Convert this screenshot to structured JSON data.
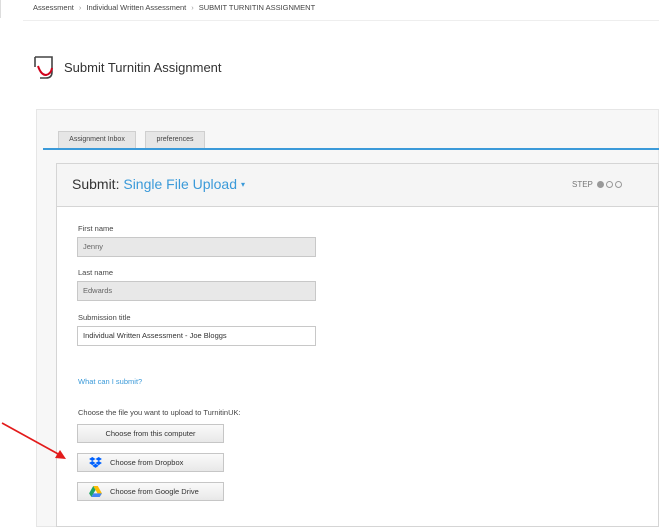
{
  "breadcrumb": {
    "item1": "Assessment",
    "item2": "Individual Written Assessment",
    "item3": "SUBMIT TURNITIN ASSIGNMENT",
    "separator": "›"
  },
  "page": {
    "title": "Submit Turnitin Assignment"
  },
  "tabs": [
    {
      "label": "Assignment Inbox"
    },
    {
      "label": "preferences"
    }
  ],
  "submit": {
    "prefix": "Submit:",
    "mode": "Single File Upload",
    "step_label": "STEP",
    "step_current": 1,
    "step_total": 3
  },
  "form": {
    "first_name_label": "First name",
    "first_name_value": "Jenny",
    "last_name_label": "Last name",
    "last_name_value": "Edwards",
    "submission_title_label": "Submission title",
    "submission_title_value": "Individual Written Assessment - Joe Bloggs",
    "what_link": "What can I submit?",
    "choose_text": "Choose the file you want to upload to TurnitinUK:",
    "btn_computer": "Choose from this computer",
    "btn_dropbox": "Choose from Dropbox",
    "btn_drive": "Choose from Google Drive"
  },
  "colors": {
    "accent": "#3b9ad9",
    "annotation_arrow": "#e31b1b",
    "dropbox": "#0061fe"
  },
  "icons": [
    "turnitin-logo-icon",
    "caret-down-icon",
    "dropbox-icon",
    "google-drive-icon"
  ]
}
